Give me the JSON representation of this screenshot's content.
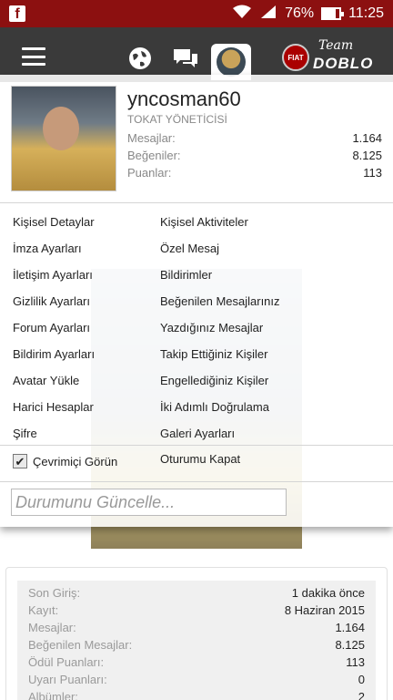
{
  "statusbar": {
    "fb_glyph": "f",
    "wifi_icon": "wifi-icon",
    "signal_icon": "signal-icon",
    "battery_percent": "76%",
    "time": "11:25"
  },
  "navbar": {
    "logo_brand": "FIAT",
    "logo_team": "Team",
    "logo_model": "DOBLO"
  },
  "profile": {
    "username": "yncosman60",
    "title": "TOKAT YÖNETİCİSİ",
    "stats": [
      {
        "label": "Mesajlar:",
        "value": "1.164"
      },
      {
        "label": "Beğeniler:",
        "value": "8.125"
      },
      {
        "label": "Puanlar:",
        "value": "113"
      }
    ]
  },
  "menu": {
    "left": [
      "Kişisel Detaylar",
      "İmza Ayarları",
      "İletişim Ayarları",
      "Gizlilik Ayarları",
      "Forum Ayarları",
      "Bildirim Ayarları",
      "Avatar Yükle",
      "Harici Hesaplar",
      "Şifre"
    ],
    "right": [
      "Kişisel Aktiviteler",
      "Özel Mesaj",
      "Bildirimler",
      "Beğenilen Mesajlarınız",
      "Yazdığınız Mesajlar",
      "Takip Ettiğiniz Kişiler",
      "Engellediğiniz Kişiler",
      "İki Adımlı Doğrulama",
      "Galeri Ayarları"
    ]
  },
  "presence": {
    "label": "Çevrimiçi Görün",
    "checked": true
  },
  "logout_label": "Oturumu Kapat",
  "status_input": {
    "placeholder": "Durumunu Güncelle..."
  },
  "info": [
    {
      "label": "Son Giriş:",
      "value": "1 dakika önce"
    },
    {
      "label": "Kayıt:",
      "value": "8 Haziran 2015"
    },
    {
      "label": "Mesajlar:",
      "value": "1.164"
    },
    {
      "label": "Beğenilen Mesajlar:",
      "value": "8.125"
    },
    {
      "label": "Ödül Puanları:",
      "value": "113"
    },
    {
      "label": "Uyarı Puanları:",
      "value": "0"
    },
    {
      "label": "Albümler:",
      "value": "2"
    }
  ]
}
